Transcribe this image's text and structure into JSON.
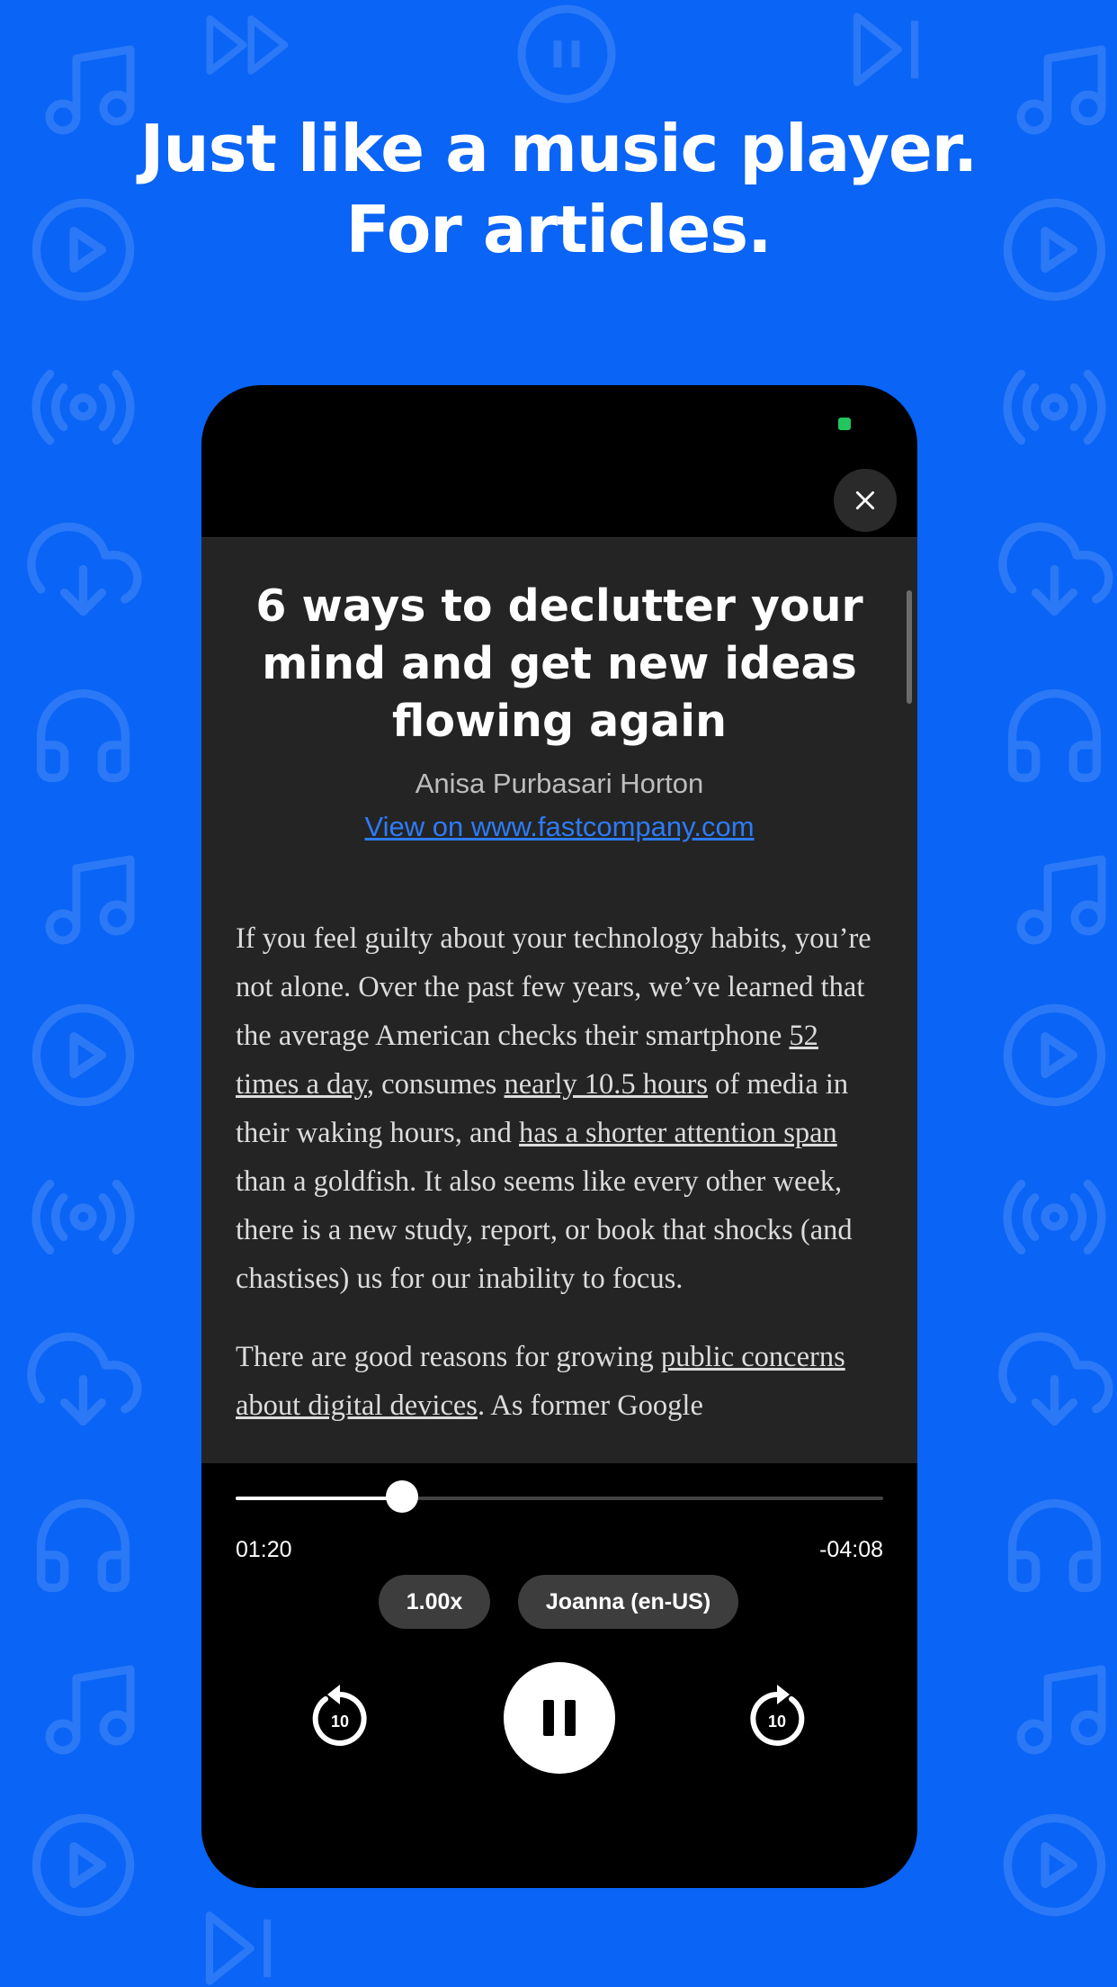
{
  "headline": {
    "line1": "Just like a music player.",
    "line2": "For articles."
  },
  "colors": {
    "background": "#0a64f5",
    "accent_link": "#2d7bf7",
    "status_indicator": "#22c55e"
  },
  "article": {
    "title": "6 ways to declutter your mind and get new ideas flowing again",
    "author": "Anisa Purbasari Horton",
    "source_link": "View on www.fastcompany.com",
    "p1": {
      "t1": "If you feel guilty about your technology habits, you’re not alone. Over the past few years, we’ve learned that the average American checks their smartphone ",
      "link1": "52 times a day",
      "t2": ", consumes ",
      "link2": "nearly 10.5 hours",
      "t3": " of media in their waking hours, and ",
      "link3": "has a shorter attention span",
      "t4": " than a goldfish. It also seems like every other week, there is a new study, report, or book that shocks (and chastises) us for our inability to focus."
    },
    "p2": {
      "t1": "There are good reasons for growing ",
      "link1": "public concerns about digital devices",
      "t2": ". As former Google"
    }
  },
  "player": {
    "elapsed": "01:20",
    "remaining": "-04:08",
    "progress": 0.257,
    "speed": "1.00x",
    "voice": "Joanna (en-US)",
    "skip_back_seconds": "10",
    "skip_forward_seconds": "10",
    "state": "playing"
  },
  "icons": {
    "close": "close-icon",
    "pause": "pause-icon",
    "skip_back": "rewind-10-icon",
    "skip_forward": "forward-10-icon"
  }
}
